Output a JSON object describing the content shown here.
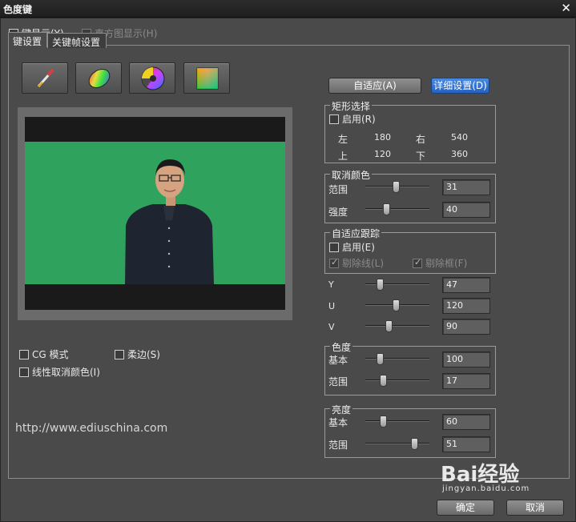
{
  "window": {
    "title": "色度键",
    "close_glyph": "✕"
  },
  "top_checks": {
    "key_display": {
      "label": "键显示(Y)",
      "checked": false
    },
    "histogram_display": {
      "label": "直方图显示(H)",
      "checked": false,
      "enabled": false
    }
  },
  "tabs": [
    {
      "label": "键设置",
      "active": true
    },
    {
      "label": "关键帧设置",
      "active": false
    }
  ],
  "tools": [
    "eyedropper-icon",
    "color-ellipse-icon",
    "color-wheel-icon",
    "color-square-icon"
  ],
  "options": {
    "cg_mode": "CG 模式",
    "soft_edge": "柔边(S)",
    "linear_unkey": "线性取消颜色(I)"
  },
  "url_text": "http://www.ediuschina.com",
  "buttons": {
    "auto_adapt": "自适应(A)",
    "detail_settings": "详细设置(D)",
    "ok": "确定",
    "cancel": "取消"
  },
  "rect_select": {
    "title": "矩形选择",
    "enable_label": "启用(R)",
    "left_label": "左",
    "left_value": "180",
    "right_label": "右",
    "right_value": "540",
    "top_label": "上",
    "top_value": "120",
    "bottom_label": "下",
    "bottom_value": "360"
  },
  "cancel_color": {
    "title": "取消颜色",
    "range_label": "范围",
    "range_value": "31",
    "strength_label": "强度",
    "strength_value": "40"
  },
  "adaptive_tracking": {
    "title": "自适应跟踪",
    "enable_label": "启用(E)",
    "remove_line_label": "剔除线(L)",
    "remove_box_label": "剔除框(F)"
  },
  "yuv": {
    "y_label": "Y",
    "y_value": "47",
    "u_label": "U",
    "u_value": "120",
    "v_label": "V",
    "v_value": "90"
  },
  "chroma": {
    "title": "色度",
    "base_label": "基本",
    "base_value": "100",
    "range_label": "范围",
    "range_value": "17"
  },
  "luma": {
    "title": "亮度",
    "base_label": "基本",
    "base_value": "60",
    "range_label": "范围",
    "range_value": "51"
  },
  "watermark": {
    "main": "Bai经验",
    "sub": "jingyan.baidu.com"
  },
  "colors": {
    "green_screen": "#2fa35e",
    "accent_button": "#2f6fd3",
    "dialog_bg": "#4a4a4a"
  }
}
